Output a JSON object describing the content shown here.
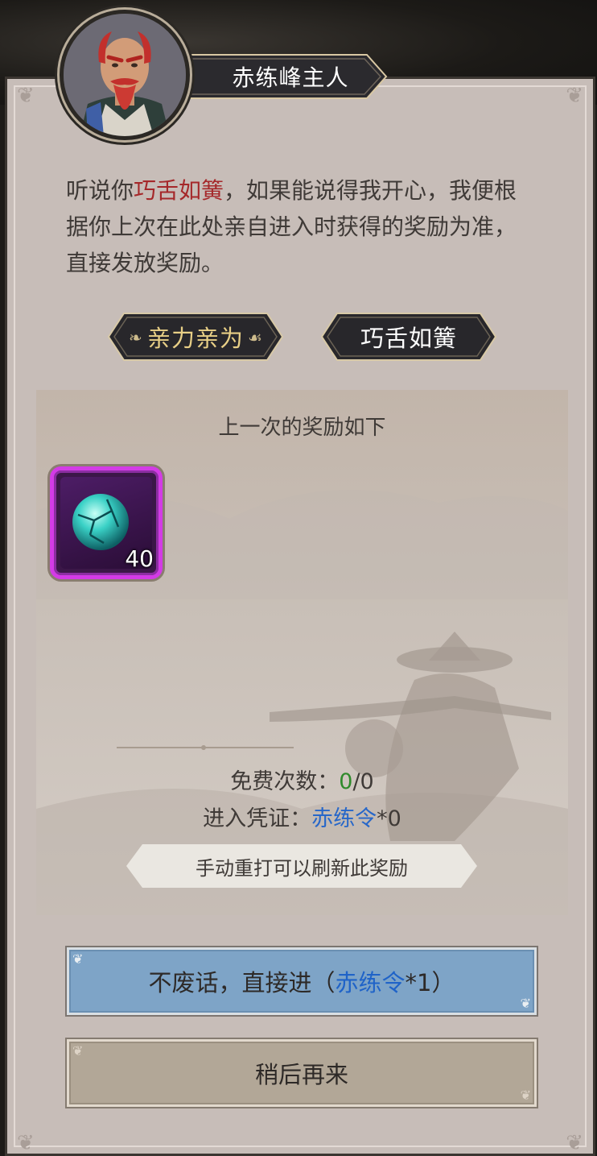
{
  "npc": {
    "name": "赤练峰主人"
  },
  "dialog": {
    "text_before": "听说你",
    "highlight": "巧舌如簧",
    "text_after": "，如果能说得我开心，我便根据你上次在此处亲自进入时获得的奖励为准，直接发放奖励。"
  },
  "choices": {
    "personal_label": "亲力亲为",
    "persuade_label": "巧舌如簧"
  },
  "reward": {
    "title": "上一次的奖励如下",
    "item": {
      "icon": "cyan-gem-orb-icon",
      "count": "40"
    },
    "free_label": "免费次数：",
    "free_used": "0",
    "free_total": "/0",
    "token_label": "进入凭证：",
    "token_name": "赤练令",
    "token_count": "*0",
    "hint": "手动重打可以刷新此奖励"
  },
  "buttons": {
    "enter_prefix": "不废话，直接进（",
    "enter_token": "赤练令",
    "enter_suffix": "*1）",
    "later_label": "稍后再来"
  },
  "colors": {
    "highlight_red": "#a5282a",
    "token_blue": "#2767c9",
    "free_green": "#2f8a2b",
    "rarity_purple": "#d33be6",
    "enter_button": "#7ea4c7",
    "later_button": "#b2a797"
  }
}
